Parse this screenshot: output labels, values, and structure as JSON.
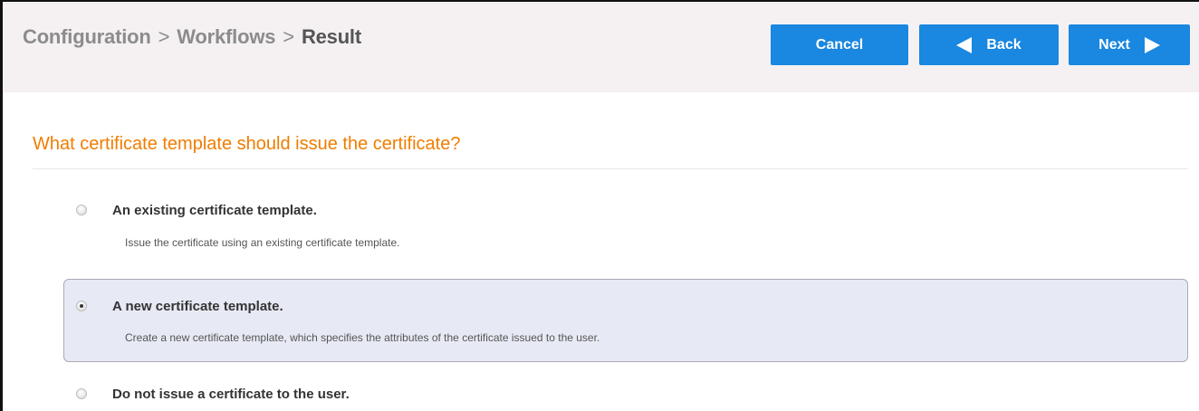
{
  "breadcrumb": {
    "items": [
      "Configuration",
      "Workflows"
    ],
    "current": "Result",
    "separator": ">"
  },
  "toolbar": {
    "cancel_label": "Cancel",
    "back_label": "Back",
    "next_label": "Next"
  },
  "question": "What certificate template should issue the certificate?",
  "options": [
    {
      "title": "An existing certificate template.",
      "description": "Issue the certificate using an existing certificate template.",
      "selected": false
    },
    {
      "title": "A new certificate template.",
      "description": "Create a new certificate template, which specifies the attributes of the certificate issued to the user.",
      "selected": true
    },
    {
      "title": "Do not issue a certificate to the user.",
      "description": "",
      "selected": false
    }
  ],
  "colors": {
    "accent_button": "#1a87e0",
    "question_text": "#f07d00",
    "header_background": "#f5f1f3",
    "selected_option_background": "#e7eaf4"
  },
  "icons": {
    "back": "triangle-left-icon",
    "next": "triangle-right-icon"
  }
}
